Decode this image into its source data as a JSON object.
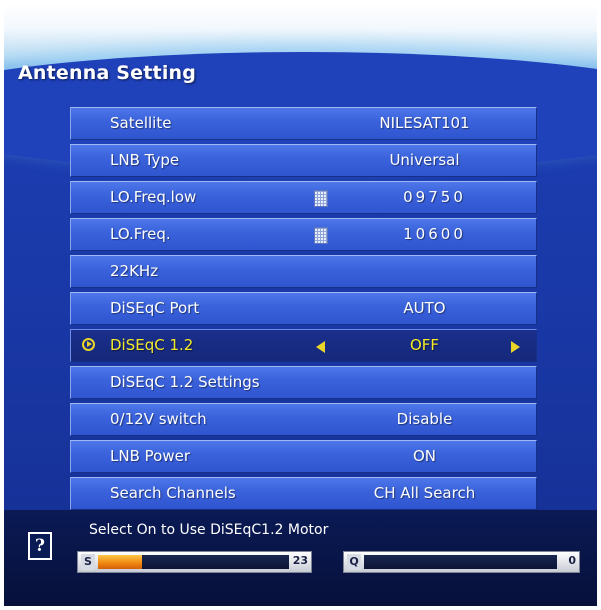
{
  "screen": {
    "title": "Antenna Setting"
  },
  "menu": {
    "rows": [
      {
        "label": "Satellite",
        "value": "NILESAT101"
      },
      {
        "label": "LNB Type",
        "value": "Universal"
      },
      {
        "label": "LO.Freq.low",
        "value": "09750",
        "icon": "keypad-icon"
      },
      {
        "label": "LO.Freq.",
        "value": "10600",
        "icon": "keypad-icon"
      },
      {
        "label": "22KHz",
        "value": ""
      },
      {
        "label": "DiSEqC Port",
        "value": "AUTO"
      },
      {
        "label": "DiSEqC 1.2",
        "value": "OFF",
        "selected": true
      },
      {
        "label": "DiSEqC 1.2 Settings",
        "value": ""
      },
      {
        "label": "0/12V switch",
        "value": "Disable"
      },
      {
        "label": "LNB Power",
        "value": "ON"
      },
      {
        "label": "Search Channels",
        "value": "CH All Search"
      }
    ]
  },
  "footer": {
    "help_icon": "?",
    "hint": "Select On to Use DiSEqC1.2 Motor",
    "signal": {
      "label": "S",
      "value": "23",
      "level_percent": 23
    },
    "quality": {
      "label": "Q",
      "value": "0",
      "level_percent": 0
    }
  },
  "colors": {
    "selected_text": "#f4ea2a",
    "row_blue": "#3b63dc",
    "background": "#1a39a8",
    "signal_fill": "#f08a12"
  }
}
